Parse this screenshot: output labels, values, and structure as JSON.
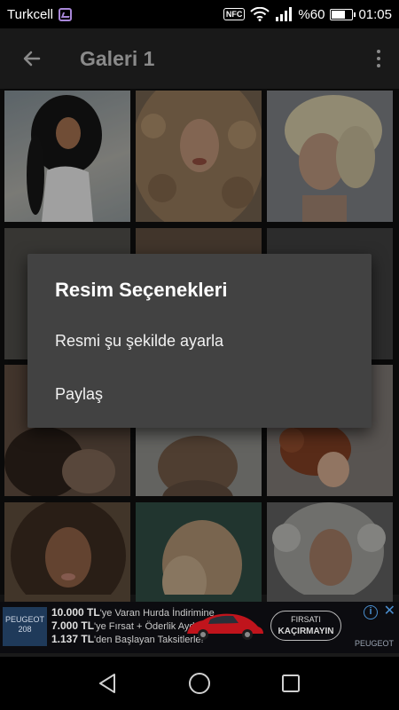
{
  "status_bar": {
    "carrier": "Turkcell",
    "nfc": "NFC",
    "battery_text": "%60",
    "battery_level": 0.6,
    "time": "01:05",
    "icons": [
      "gallery-notification-icon",
      "nfc-icon",
      "wifi-icon",
      "signal-icon",
      "battery-icon"
    ]
  },
  "app_bar": {
    "title": "Galeri 1",
    "back_icon": "arrow-left-icon",
    "menu_icon": "more-vert-icon"
  },
  "gallery": {
    "images": [
      {
        "label": "curly-hair-photo-1"
      },
      {
        "label": "curly-hair-photo-2"
      },
      {
        "label": "curly-hair-photo-3"
      },
      {
        "label": "curly-hair-photo-4"
      },
      {
        "label": "curly-hair-photo-5"
      },
      {
        "label": "curly-hair-photo-6"
      },
      {
        "label": "curly-hair-photo-7"
      },
      {
        "label": "curly-hair-photo-8"
      },
      {
        "label": "curly-hair-photo-9"
      },
      {
        "label": "curly-hair-photo-10"
      },
      {
        "label": "curly-hair-photo-11"
      },
      {
        "label": "curly-hair-photo-12"
      }
    ]
  },
  "dialog": {
    "title": "Resim Seçenekleri",
    "items": [
      {
        "label": "Resmi şu şekilde ayarla"
      },
      {
        "label": "Paylaş"
      }
    ]
  },
  "ad": {
    "brand_left": "PEUGEOT 208",
    "line1_amount": "10.000 TL",
    "line1_text": "'ye Varan Hurda İndirimine",
    "line2_amount": "7.000 TL",
    "line2_text": "'ye Fırsat + Öderlik Aydın",
    "line3_amount": "1.137 TL",
    "line3_text": "'den Başlayan Taksitlerle!",
    "cta_line1": "FIRSATI",
    "cta_line2": "KAÇIRMAYIN",
    "brand_right": "PEUGEOT",
    "info": "i",
    "close": "✕"
  },
  "nav_bar": {
    "back": "nav-back-icon",
    "home": "nav-home-icon",
    "recents": "nav-recents-icon"
  },
  "colors": {
    "dialog_bg": "#424242",
    "app_bar_bg": "#191919",
    "status_bar_bg": "#000000"
  }
}
